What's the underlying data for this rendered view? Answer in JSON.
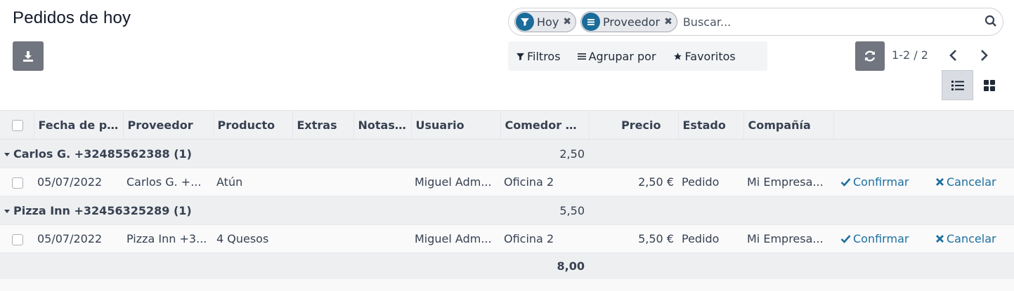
{
  "page": {
    "title": "Pedidos de hoy"
  },
  "search": {
    "facets": [
      {
        "label": "Hoy",
        "icon": "filter-icon",
        "remove": "✖"
      },
      {
        "label": "Proveedor",
        "icon": "group-by-icon",
        "remove": "✖"
      }
    ],
    "placeholder": "Buscar..."
  },
  "filter_bar": {
    "filters": "Filtros",
    "group_by": "Agrupar por",
    "favorites": "Favoritos"
  },
  "pager": {
    "value": "1-2 / 2"
  },
  "colors": {
    "accent": "#1b6c9a",
    "link": "#1c6f9e",
    "button": "#71757f"
  },
  "table": {
    "columns": [
      "Fecha de p...",
      "Proveedor",
      "Producto",
      "Extras",
      "Notas...",
      "Usuario",
      "Comedor d...",
      "Precio",
      "Estado",
      "Compañía"
    ],
    "groups": [
      {
        "label": "Carlos G. +32485562388 (1)",
        "subtotal": "2,50",
        "rows": [
          {
            "fecha": "05/07/2022",
            "proveedor": "Carlos G. +...",
            "producto": "Atún",
            "extras": "",
            "notas": "",
            "usuario": "Miguel Adm...",
            "comedor": "Oficina 2",
            "precio": "2,50 €",
            "estado": "Pedido",
            "compania": "Mi Empresa...",
            "confirm": "Confirmar",
            "cancel": "Cancelar"
          }
        ]
      },
      {
        "label": "Pizza Inn +32456325289 (1)",
        "subtotal": "5,50",
        "rows": [
          {
            "fecha": "05/07/2022",
            "proveedor": "Pizza Inn +3...",
            "producto": "4 Quesos",
            "extras": "",
            "notas": "",
            "usuario": "Miguel Adm...",
            "comedor": "Oficina 2",
            "precio": "5,50 €",
            "estado": "Pedido",
            "compania": "Mi Empresa...",
            "confirm": "Confirmar",
            "cancel": "Cancelar"
          }
        ]
      }
    ],
    "total": "8,00"
  }
}
